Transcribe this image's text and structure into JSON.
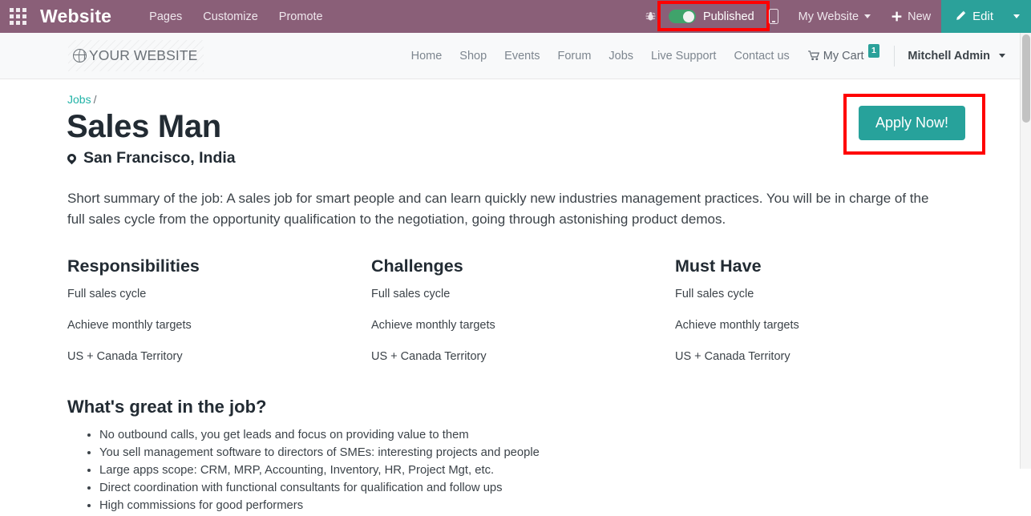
{
  "editor_topbar": {
    "apps_icon": "apps-grid-icon",
    "brand": "Website",
    "menus": [
      "Pages",
      "Customize",
      "Promote"
    ],
    "debug_icon": "bug-icon",
    "published_label": "Published",
    "published_state": "on",
    "mobile_preview_icon": "mobile-phone-icon",
    "site_selector": "My Website",
    "new_label": "New",
    "new_icon": "plus-icon",
    "edit_label": "Edit",
    "edit_icon": "pencil-icon",
    "bar_color": "#8a5f78",
    "accent_color": "#2ba19a",
    "toggle_on_color": "#3fa36b"
  },
  "site_header": {
    "logo_text": "YOUR WEBSITE",
    "logo_icon": "globe-icon",
    "nav": [
      "Home",
      "Shop",
      "Events",
      "Forum",
      "Jobs",
      "Live Support",
      "Contact us"
    ],
    "cart_label": "My Cart",
    "cart_icon": "shopping-cart-icon",
    "cart_count": "1",
    "user_name": "Mitchell Admin"
  },
  "job": {
    "breadcrumb_parent": "Jobs",
    "breadcrumb_separator": "/",
    "title": "Sales Man",
    "location_icon": "map-pin-icon",
    "location": "San Francisco, India",
    "apply_label": "Apply Now!",
    "summary": "Short summary of the job: A sales job for smart people and can learn quickly new industries management practices. You will be in charge of the full sales cycle from the opportunity qualification to the negotiation, going through astonishing product demos.",
    "columns": [
      {
        "heading": "Responsibilities",
        "items": [
          "Full sales cycle",
          "Achieve monthly targets",
          "US + Canada Territory"
        ]
      },
      {
        "heading": "Challenges",
        "items": [
          "Full sales cycle",
          "Achieve monthly targets",
          "US + Canada Territory"
        ]
      },
      {
        "heading": "Must Have",
        "items": [
          "Full sales cycle",
          "Achieve monthly targets",
          "US + Canada Territory"
        ]
      }
    ],
    "great_heading": "What's great in the job?",
    "great_items": [
      "No outbound calls, you get leads and focus on providing value to them",
      "You sell management software to directors of SMEs: interesting projects and people",
      "Large apps scope: CRM, MRP, Accounting, Inventory, HR, Project Mgt, etc.",
      "Direct coordination with functional consultants for qualification and follow ups",
      "High commissions for good performers"
    ]
  },
  "annotations": {
    "published_highlight_color": "#ff0000",
    "apply_highlight_color": "#ff0000"
  }
}
